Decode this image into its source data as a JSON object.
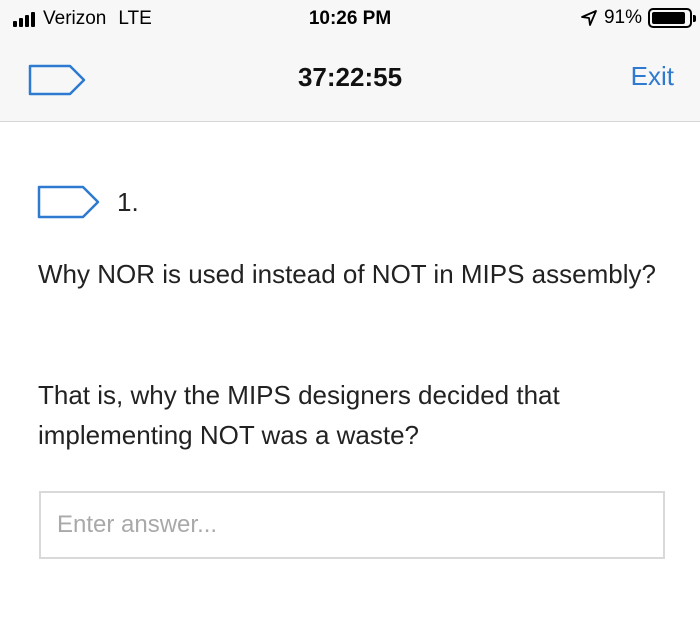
{
  "status_bar": {
    "carrier": "Verizon",
    "network": "LTE",
    "time": "10:26 PM",
    "battery_percent": "91%",
    "battery_level": 0.91,
    "icons": [
      "signal-bars-icon",
      "location-arrow-icon",
      "battery-icon"
    ]
  },
  "nav": {
    "timer": "37:22:55",
    "exit_label": "Exit",
    "flag_icon": "bookmark-flag-icon",
    "accent_color": "#2e7ad1"
  },
  "question": {
    "number": "1.",
    "flag_icon": "bookmark-flag-icon",
    "text": "Why NOR is used instead of NOT in MIPS assembly?",
    "followup": "That is, why the MIPS designers decided that implementing NOT was a waste?"
  },
  "answer": {
    "placeholder": "Enter answer...",
    "value": ""
  }
}
